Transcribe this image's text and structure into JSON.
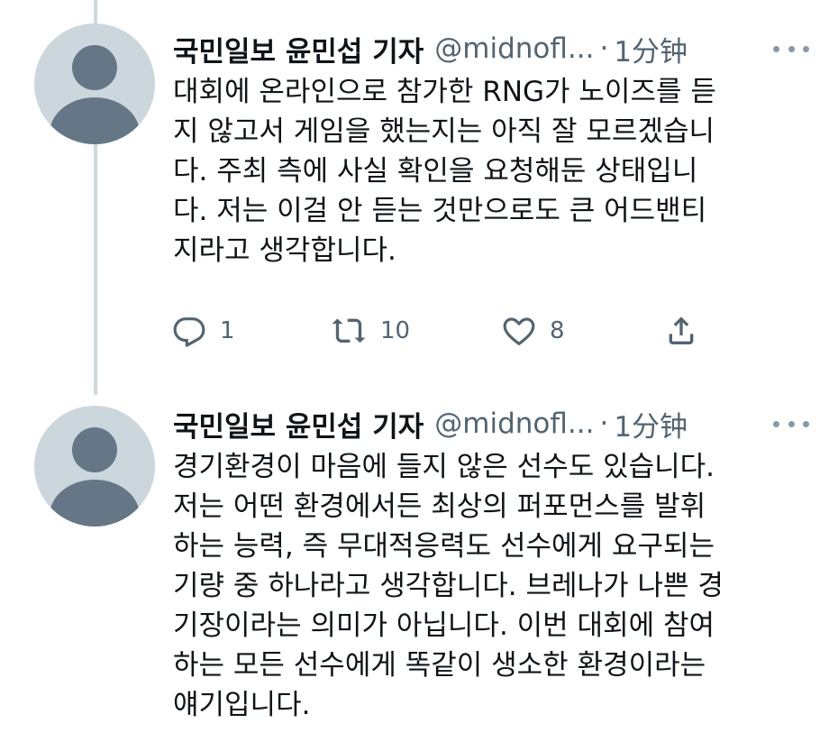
{
  "tweets": [
    {
      "author_name": "국민일보 윤민섭 기자",
      "handle": "@midnofl...",
      "separator": "·",
      "time": "1分钟",
      "text": "대회에 온라인으로 참가한 RNG가 노이즈를 듣\n지 않고서 게임을 했는지는 아직 잘 모르겠습니\n다. 주최 측에 사실 확인을 요청해둔 상태입니\n다. 저는 이걸 안 듣는 것만으로도 큰 어드밴티\n지라고 생각합니다.",
      "actions": {
        "reply_count": "1",
        "retweet_count": "10",
        "like_count": "8"
      }
    },
    {
      "author_name": "국민일보 윤민섭 기자",
      "handle": "@midnofl...",
      "separator": "·",
      "time": "1分钟",
      "text": "경기환경이 마음에 들지 않은 선수도 있습니다.\n저는 어떤 환경에서든 최상의 퍼포먼스를 발휘\n하는 능력, 즉 무대적응력도 선수에게 요구되는\n기량 중 하나라고 생각합니다. 브레나가 나쁜 경\n기장이라는 의미가 아닙니다. 이번 대회에 참여\n하는 모든 선수에게 똑같이 생소한 환경이라는\n얘기입니다."
    }
  ],
  "icons": {
    "reply": "reply-icon",
    "retweet": "retweet-icon",
    "like": "heart-icon",
    "share": "share-icon",
    "more": "more-icon",
    "avatar": "default-avatar-icon"
  },
  "colors": {
    "text": "#0f1419",
    "secondary": "#536471",
    "thread_line": "#cfd9de",
    "avatar_bg": "#ccd6dd",
    "avatar_fg": "#657786"
  }
}
